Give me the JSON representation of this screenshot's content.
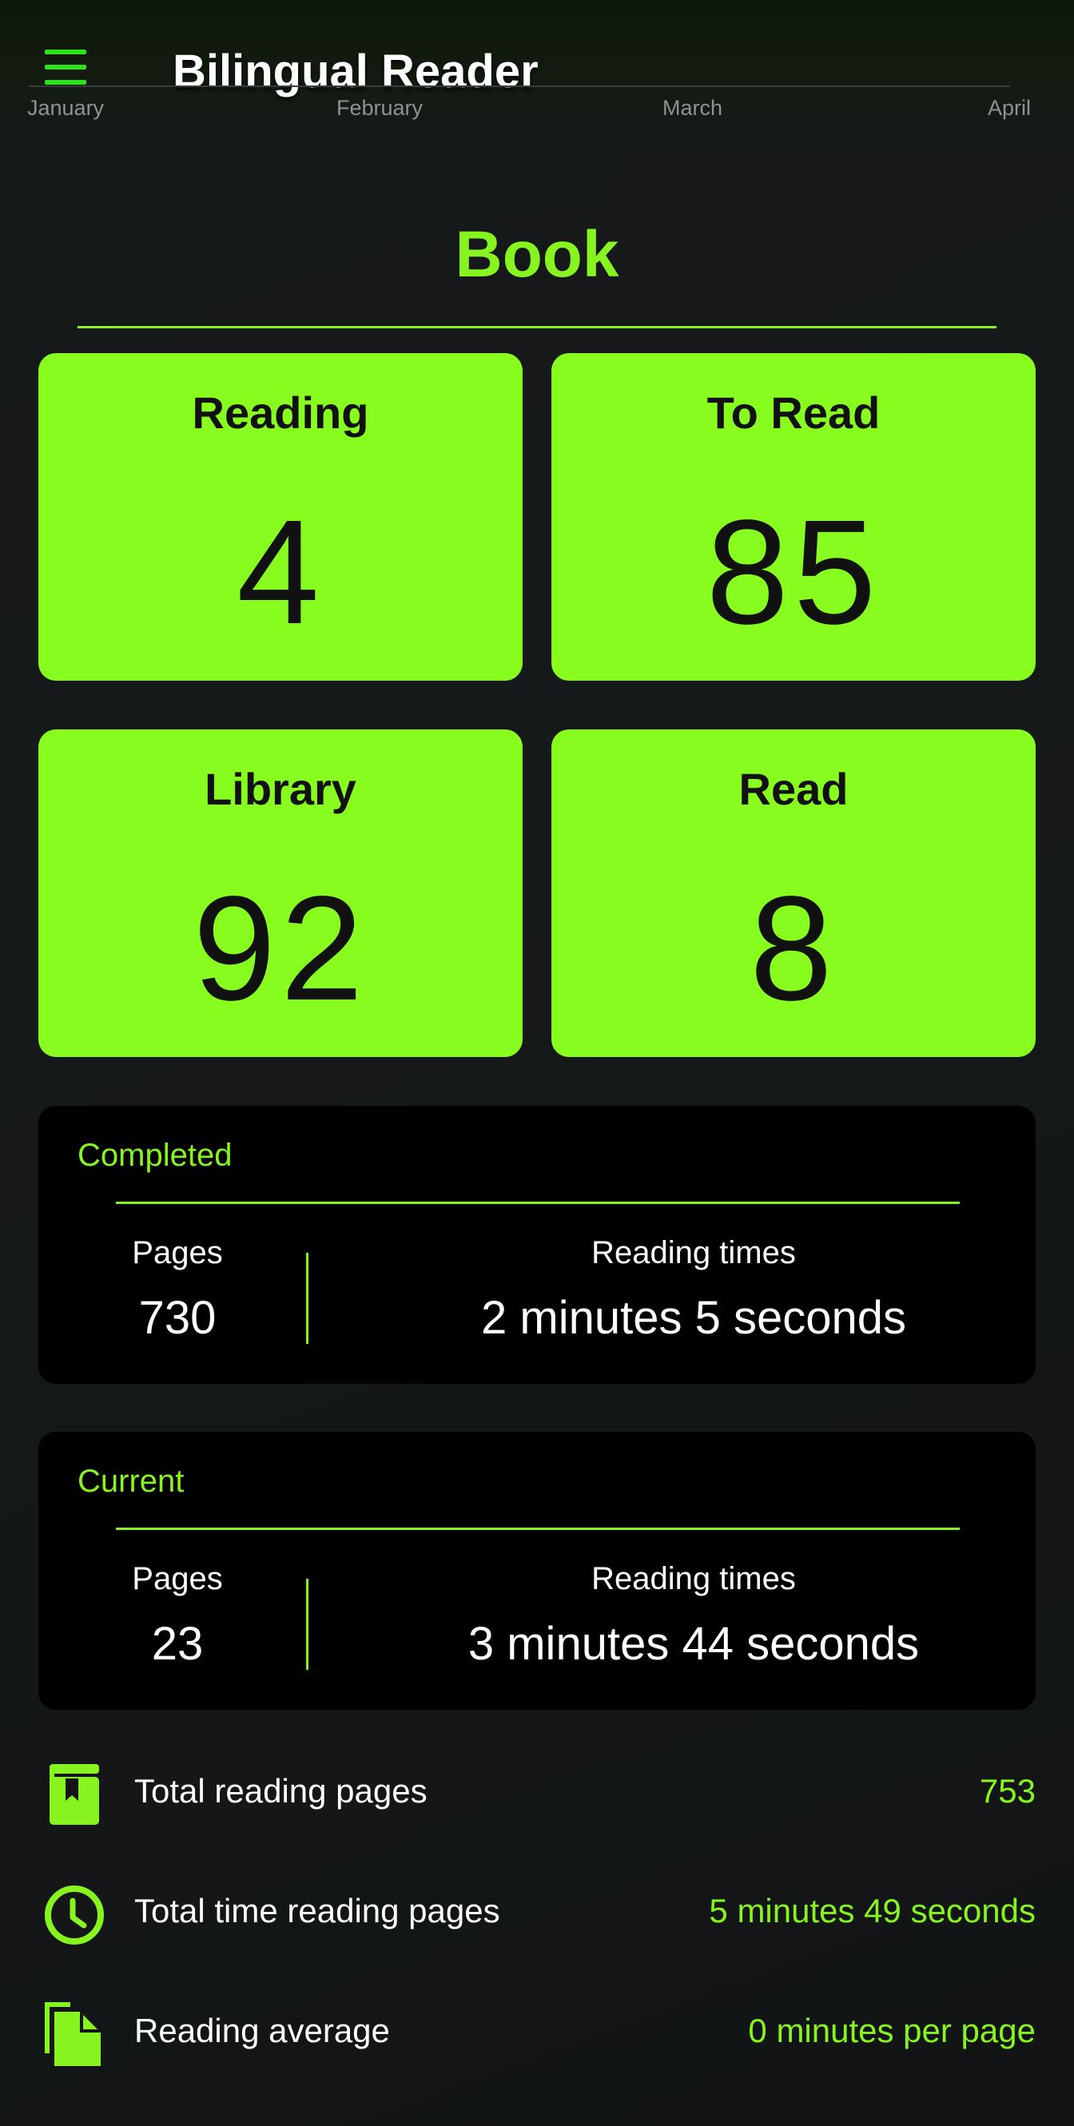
{
  "app": {
    "title": "Bilingual Reader",
    "accent_color": "#87f41f",
    "menu_icon": "hamburger-menu-icon"
  },
  "timeline": {
    "months": [
      "January",
      "February",
      "March",
      "April"
    ]
  },
  "section": {
    "title": "Book"
  },
  "tiles": [
    {
      "label": "Reading",
      "value": "4"
    },
    {
      "label": "To Read",
      "value": "85"
    },
    {
      "label": "Library",
      "value": "92"
    },
    {
      "label": "Read",
      "value": "8"
    }
  ],
  "completed": {
    "title": "Completed",
    "pages_label": "Pages",
    "pages_value": "730",
    "time_label": "Reading times",
    "time_value": "2 minutes 5 seconds"
  },
  "current": {
    "title": "Current",
    "pages_label": "Pages",
    "pages_value": "23",
    "time_label": "Reading times",
    "time_value": "3 minutes 44 seconds"
  },
  "totals": [
    {
      "icon": "book-icon",
      "label": "Total reading pages",
      "value": "753"
    },
    {
      "icon": "clock-icon",
      "label": "Total time reading pages",
      "value": "5 minutes 49 seconds"
    },
    {
      "icon": "pages-icon",
      "label": "Reading average",
      "value": "0 minutes per page"
    }
  ]
}
